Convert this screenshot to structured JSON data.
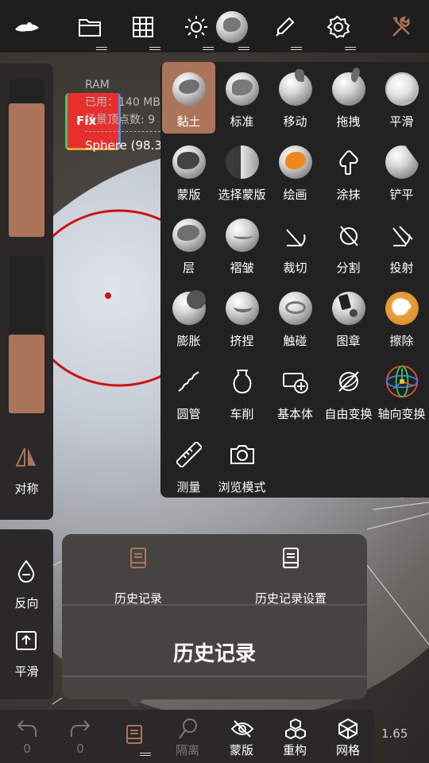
{
  "topbar": {
    "items": [
      "logo",
      "folder",
      "grid",
      "sun",
      "material",
      "brush",
      "gear",
      "tools"
    ]
  },
  "info": {
    "ram_label": "RAM",
    "used": "已用：140 MB",
    "verts": "场景顶点数: 9",
    "sphere": "Sphere (98.3",
    "fix_label": "Fix"
  },
  "left_top": {
    "slider1_level": 0.85,
    "slider2_level": 0.5,
    "symmetry_label": "对称"
  },
  "left_bottom": {
    "invert_label": "反向",
    "smooth_label": "平滑"
  },
  "tools": {
    "items": [
      {
        "label": "黏土"
      },
      {
        "label": "标准"
      },
      {
        "label": "移动"
      },
      {
        "label": "拖拽"
      },
      {
        "label": "平滑"
      },
      {
        "label": "蒙版"
      },
      {
        "label": "选择蒙版"
      },
      {
        "label": "绘画"
      },
      {
        "label": "涂抹"
      },
      {
        "label": "铲平"
      },
      {
        "label": "层"
      },
      {
        "label": "褶皱"
      },
      {
        "label": "裁切"
      },
      {
        "label": "分割"
      },
      {
        "label": "投射"
      },
      {
        "label": "膨胀"
      },
      {
        "label": "挤捏"
      },
      {
        "label": "触碰"
      },
      {
        "label": "图章"
      },
      {
        "label": "擦除"
      },
      {
        "label": "圆管"
      },
      {
        "label": "车削"
      },
      {
        "label": "基本体"
      },
      {
        "label": "自由变换"
      },
      {
        "label": "轴向变换"
      },
      {
        "label": "测量"
      },
      {
        "label": "浏览模式"
      }
    ],
    "active": "黏土"
  },
  "history": {
    "tab1": "历史记录",
    "tab2": "历史记录设置",
    "title": "历史记录"
  },
  "bottombar": {
    "undo_count": "0",
    "redo_count": "0",
    "isolate": "隔离",
    "mask": "蒙版",
    "remesh": "重构",
    "mesh": "网格",
    "zoom": "1.65"
  },
  "colors": {
    "accent": "#ac7459",
    "panel": "#232222"
  }
}
